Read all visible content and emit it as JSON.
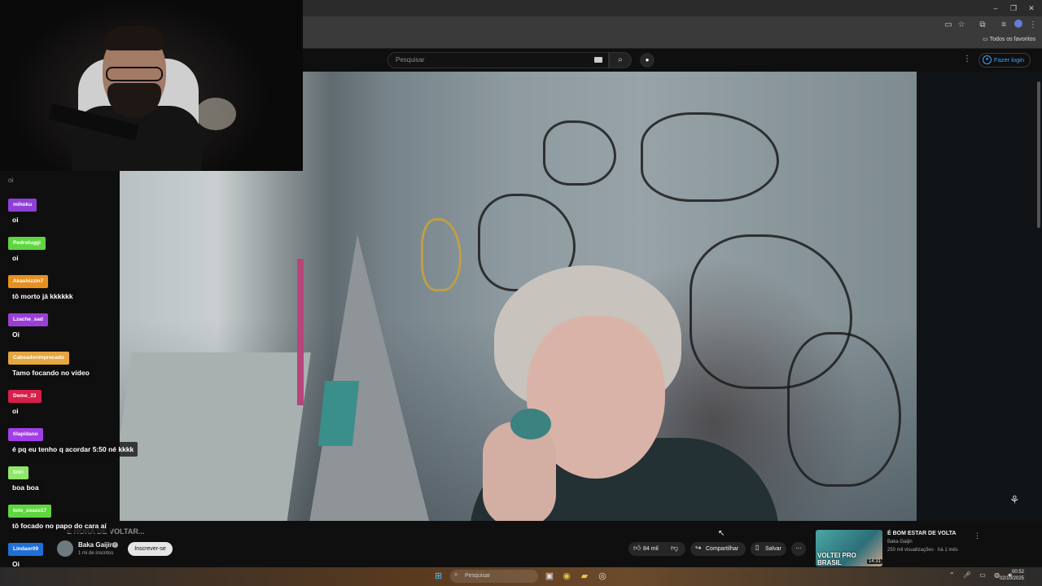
{
  "browser": {
    "bookmarks_label": "Todos os favoritos",
    "window_controls": [
      "minimize-icon",
      "restore-icon",
      "close-icon"
    ]
  },
  "header": {
    "search_placeholder": "Pesquisar",
    "login_label": "Fazer login"
  },
  "video": {
    "title_partial": "É HORA DE VOLTAR..."
  },
  "channel": {
    "name": "Baka Gaijin",
    "subscribers": "1 mi de inscritos",
    "subscribe_label": "Inscrever-se"
  },
  "actions": {
    "likes": "84 mil",
    "share_label": "Compartilhar",
    "save_label": "Salvar"
  },
  "related": {
    "title": "É BOM ESTAR DE VOLTA",
    "channel": "Baka Gaijin",
    "meta": "250 mil visualizações · há 1 mês",
    "duration": "14:31",
    "thumb_text": "VOLTEI PRO BRASIL"
  },
  "chat": {
    "top_message": "oi",
    "items": [
      {
        "user": "mihoku",
        "msg": "oi",
        "color": "#8e3fd6"
      },
      {
        "user": "Pedroluggi",
        "msg": "oi",
        "color": "#5fd63f"
      },
      {
        "user": "Akashizzin7",
        "msg": "tô morto já kkkkkk",
        "color": "#e6901f"
      },
      {
        "user": "Lzache_sad",
        "msg": "Oi",
        "color": "#9a3fd6"
      },
      {
        "user": "Cabeadorimprecado",
        "msg": "Tamo focando no vídeo",
        "color": "#e6a63f"
      },
      {
        "user": "Deme_23",
        "msg": "oi",
        "color": "#d61f4a"
      },
      {
        "user": "tilapidano",
        "msg": "é pq eu tenho q acordar 5:50 né kkkk",
        "color": "#a13fe6"
      },
      {
        "user": "tiriri",
        "msg": "boa boa",
        "color": "#8fe66a"
      },
      {
        "user": "toto_zoazo17",
        "msg": "tô focado no papo do cara aí",
        "color": "#5fd63f"
      },
      {
        "user": "Lindaor09",
        "msg": "Oi",
        "color": "#1f6fd6"
      }
    ]
  },
  "taskbar": {
    "search_placeholder": "Pesquisar",
    "time": "00:52",
    "date": "02/10/2025"
  }
}
